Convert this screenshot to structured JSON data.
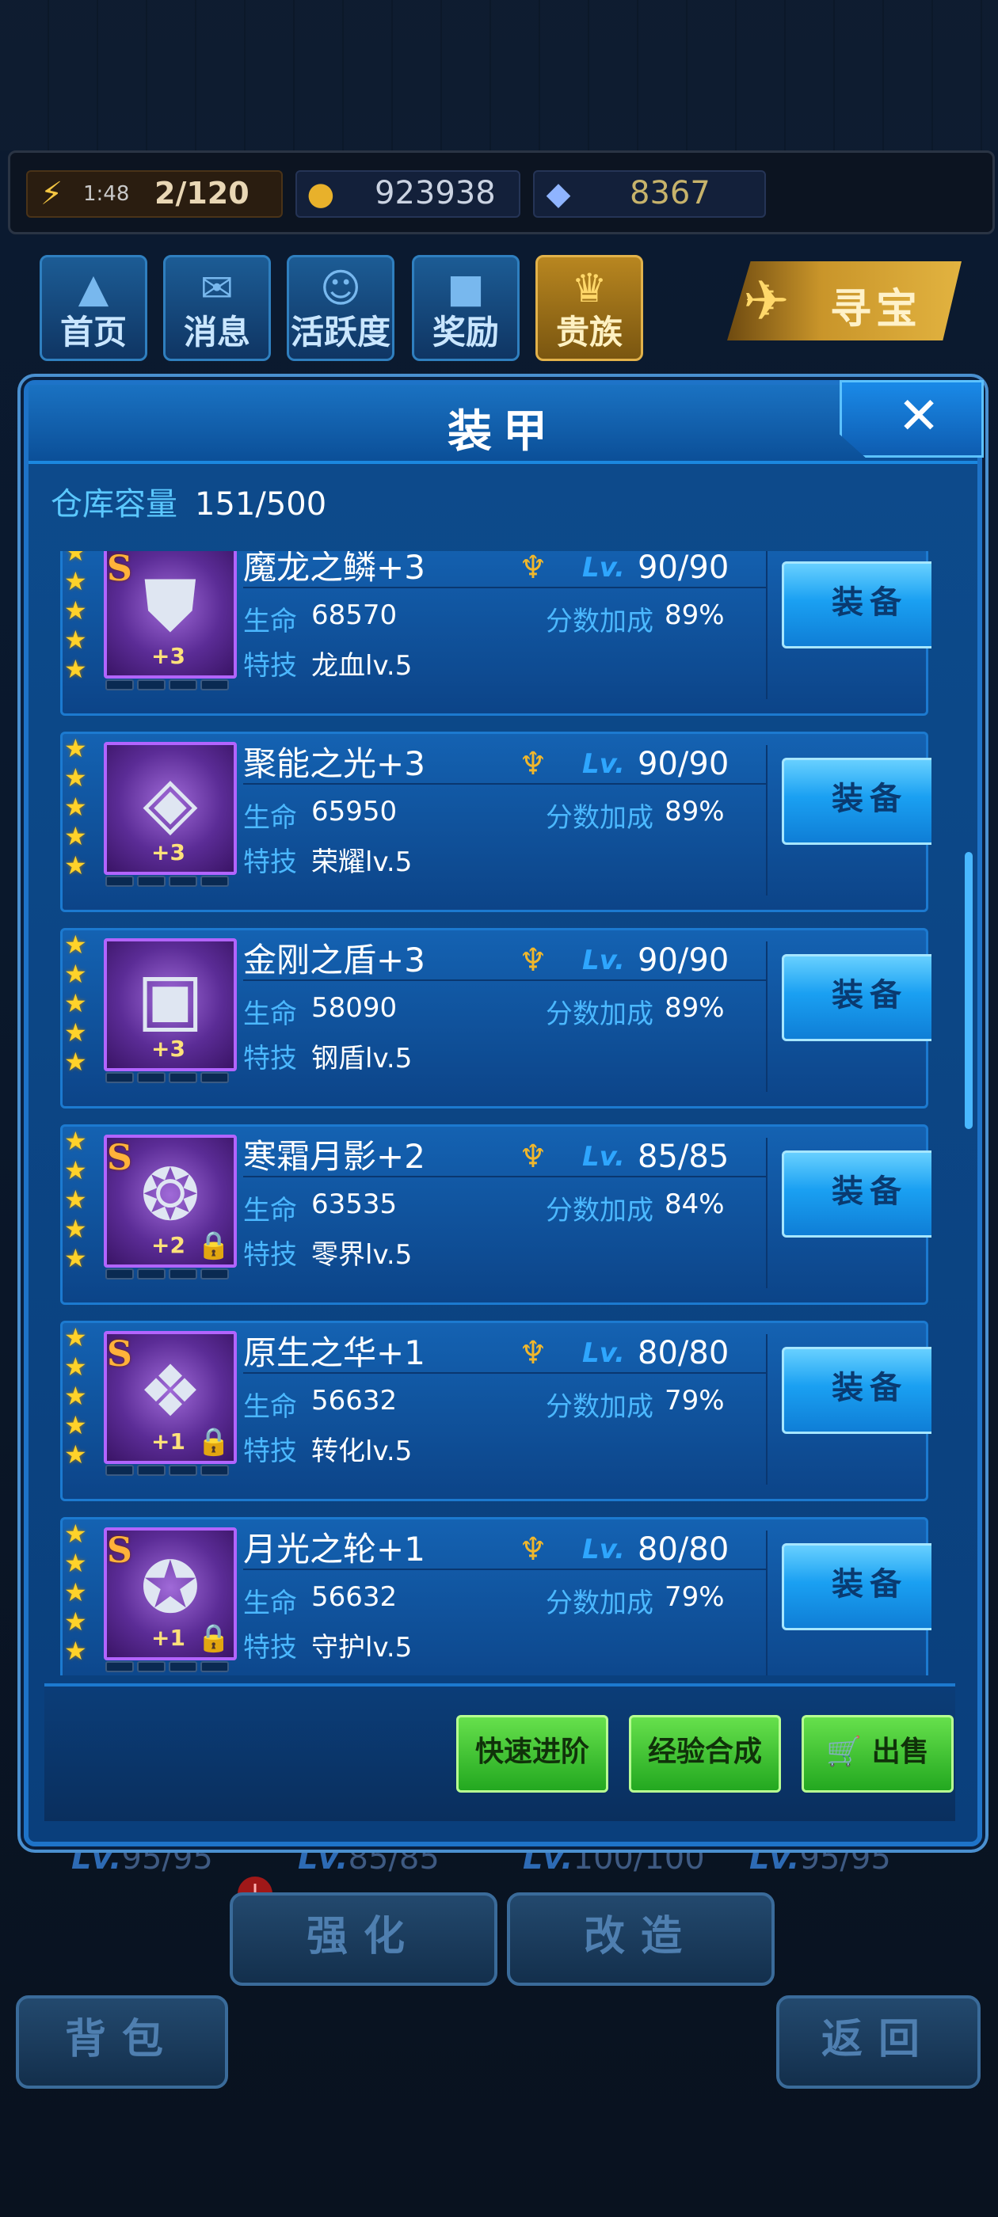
{
  "status": {
    "energy_timer": "1:48",
    "energy_count": "2/120",
    "gold": "923938",
    "gems": "8367"
  },
  "nav": [
    {
      "label": "首页",
      "icon": "home-icon"
    },
    {
      "label": "消息",
      "icon": "mail-icon"
    },
    {
      "label": "活跃度",
      "icon": "smile-icon"
    },
    {
      "label": "奖励",
      "icon": "gift-icon"
    },
    {
      "label": "贵族",
      "icon": "crown-icon"
    }
  ],
  "treasure_label": "寻宝",
  "modal": {
    "title": "装甲",
    "close": "✕",
    "capacity_label": "仓库容量",
    "capacity_value": "151/500",
    "scroll_level": 0.28
  },
  "items": [
    {
      "name": "魔龙之鳞+3",
      "lv_label": "Lv.",
      "level": "90/90",
      "hp_label": "生命",
      "hp": "68570",
      "score_label": "分数加成",
      "score": "89%",
      "skill_label": "特技",
      "skill": "龙血lv.5",
      "plus": "+3",
      "stars": 5,
      "s_rank": true,
      "locked": false,
      "equip": "装备"
    },
    {
      "name": "聚能之光+3",
      "lv_label": "Lv.",
      "level": "90/90",
      "hp_label": "生命",
      "hp": "65950",
      "score_label": "分数加成",
      "score": "89%",
      "skill_label": "特技",
      "skill": "荣耀lv.5",
      "plus": "+3",
      "stars": 5,
      "s_rank": false,
      "locked": false,
      "equip": "装备"
    },
    {
      "name": "金刚之盾+3",
      "lv_label": "Lv.",
      "level": "90/90",
      "hp_label": "生命",
      "hp": "58090",
      "score_label": "分数加成",
      "score": "89%",
      "skill_label": "特技",
      "skill": "钢盾lv.5",
      "plus": "+3",
      "stars": 5,
      "s_rank": false,
      "locked": false,
      "equip": "装备"
    },
    {
      "name": "寒霜月影+2",
      "lv_label": "Lv.",
      "level": "85/85",
      "hp_label": "生命",
      "hp": "63535",
      "score_label": "分数加成",
      "score": "84%",
      "skill_label": "特技",
      "skill": "零界lv.5",
      "plus": "+2",
      "stars": 5,
      "s_rank": true,
      "locked": true,
      "equip": "装备"
    },
    {
      "name": "原生之华+1",
      "lv_label": "Lv.",
      "level": "80/80",
      "hp_label": "生命",
      "hp": "56632",
      "score_label": "分数加成",
      "score": "79%",
      "skill_label": "特技",
      "skill": "转化lv.5",
      "plus": "+1",
      "stars": 5,
      "s_rank": true,
      "locked": true,
      "equip": "装备"
    },
    {
      "name": "月光之轮+1",
      "lv_label": "Lv.",
      "level": "80/80",
      "hp_label": "生命",
      "hp": "56632",
      "score_label": "分数加成",
      "score": "79%",
      "skill_label": "特技",
      "skill": "守护lv.5",
      "plus": "+1",
      "stars": 5,
      "s_rank": true,
      "locked": true,
      "equip": "装备"
    }
  ],
  "actions": {
    "quick_advance": "快速进阶",
    "exp_synth": "经验合成",
    "sell": "出售",
    "sell_icon": "cart-icon"
  },
  "background": {
    "levels": [
      "95/95",
      "85/85",
      "100/100",
      "95/95"
    ],
    "lv_prefix": "Lv.",
    "notice": "!",
    "enhance": "强化",
    "modify": "改造",
    "bag": "背包",
    "back": "返回"
  },
  "colors": {
    "accent": "#1c7ad0",
    "label_blue": "#4bb8ff",
    "star": "#ffd22a",
    "green_button": "#23a820"
  }
}
